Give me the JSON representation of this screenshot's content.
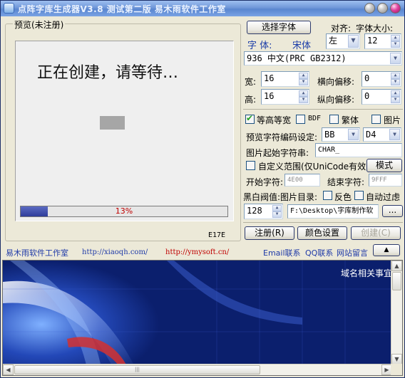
{
  "window": {
    "title": "点阵字库生成器V3.8 测试第二版 易木雨软件工作室"
  },
  "preview": {
    "group_label": "预览(未注册)",
    "message": "正在创建，请等待…",
    "progress_percent": 13,
    "progress_text": "13%",
    "current_code": "E17E"
  },
  "font": {
    "select_button": "选择字体",
    "align_label": "对齐:",
    "size_label": "字体大小:",
    "align_value": "左",
    "size_value": "12",
    "font_label": "字  体:",
    "font_name": "宋体",
    "charset": "936 中文(PRC GB2312)"
  },
  "dimensions": {
    "width_label": "宽:",
    "width_value": "16",
    "height_label": "高:",
    "height_value": "16",
    "hoffset_label": "横向偏移:",
    "hoffset_value": "0",
    "voffset_label": "纵向偏移:",
    "voffset_value": "0"
  },
  "options": {
    "equal_width_label": "等高等宽",
    "equal_width_checked": true,
    "bdf_label": "BDF",
    "bdf_checked": false,
    "traditional_label": "繁体",
    "traditional_checked": false,
    "image_label": "图片",
    "image_checked": false
  },
  "encoding": {
    "label": "预览字符编码设定:",
    "high_byte": "BB",
    "low_byte": "D4",
    "image_start_label": "图片起始字符串:",
    "image_start_value": "CHAR_"
  },
  "custom_range": {
    "label": "自定义范围(仅UniCode有效)",
    "checked": false,
    "mode_button": "模式",
    "start_label": "开始字符:",
    "start_value": "4E00",
    "end_label": "结束字符:",
    "end_value": "9FFF"
  },
  "threshold": {
    "label": "黑白阀值:",
    "image_dir_label": "图片目录:",
    "invert_label": "反色",
    "invert_checked": false,
    "auto_filter_label": "自动过虑",
    "auto_filter_checked": false,
    "value": "128",
    "path": "F:\\Desktop\\字库制作软",
    "browse_button": "..."
  },
  "actions": {
    "register": "注册(R)",
    "color_settings": "颜色设置",
    "create": "创建(C)"
  },
  "links": {
    "studio": "易木雨软件工作室",
    "url1": "http://xiaoqh.com/",
    "url2": "http://ymysoft.cn/",
    "email": "Email联系",
    "qq": "QQ联系",
    "guestbook": "网站留言",
    "collapse": "▲"
  },
  "browser": {
    "text": "域名相关事宜"
  },
  "colors": {
    "link_blue": "#1f3aa8",
    "link_red": "#c00000",
    "progress_fill": "#3a4aa8",
    "browser_bg": "#0b1f6d"
  }
}
